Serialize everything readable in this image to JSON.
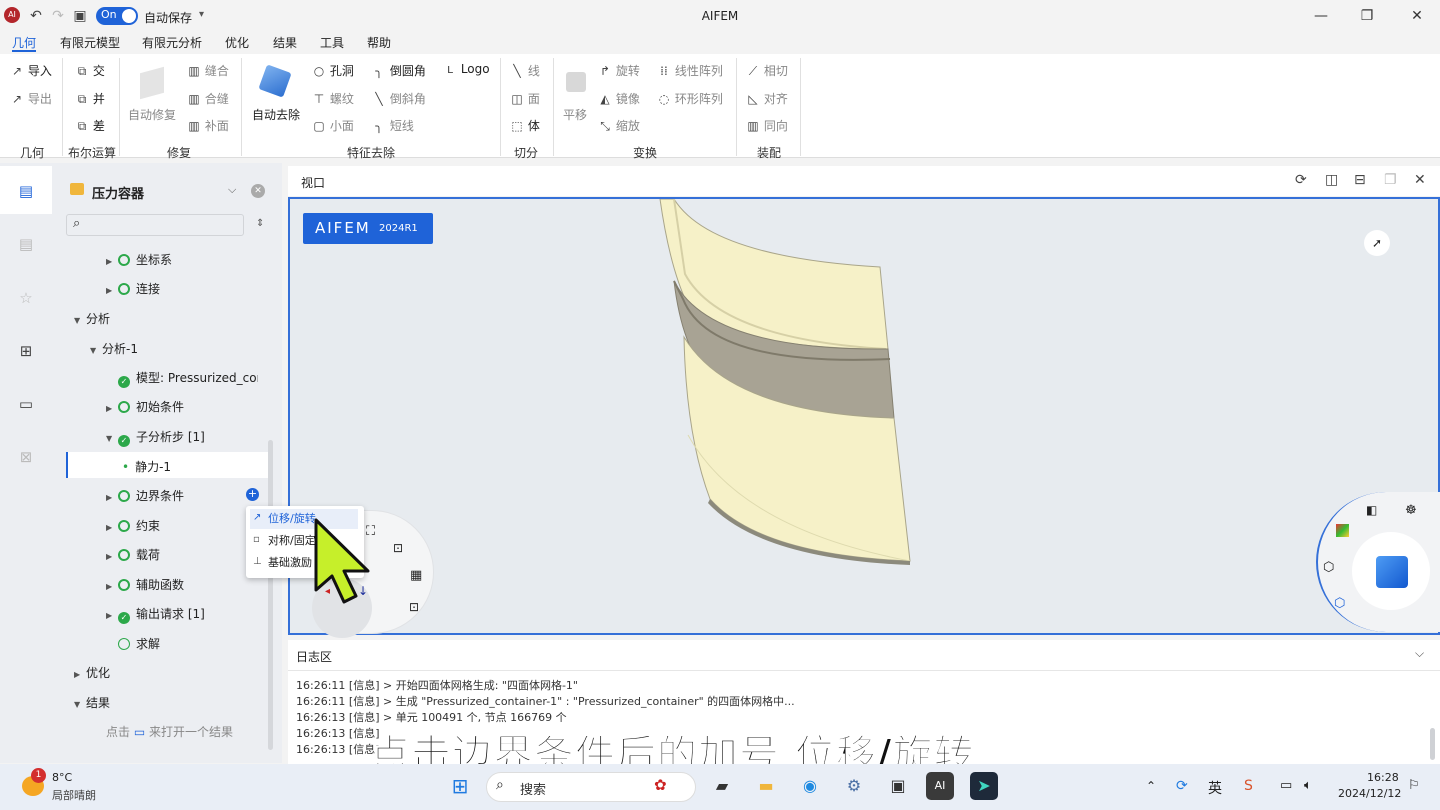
{
  "app": {
    "title": "AIFEM",
    "autosave_toggle": "On",
    "autosave_label": "自动保存",
    "logo_text": "AI"
  },
  "menu": [
    "几何",
    "有限元模型",
    "有限元分析",
    "优化",
    "结果",
    "工具",
    "帮助"
  ],
  "ribbon": {
    "geometry": {
      "import": "导入",
      "export": "导出",
      "group": "几何"
    },
    "boolean": {
      "intersect": "交",
      "union": "并",
      "subtract": "差",
      "group": "布尔运算"
    },
    "repair": {
      "auto_repair": "自动修复",
      "sew": "缝合",
      "merge": "合缝",
      "fill": "补面",
      "group": "修复"
    },
    "feature": {
      "auto_remove": "自动去除",
      "hole": "孔洞",
      "thread": "螺纹",
      "small_face": "小面",
      "fillet": "倒圆角",
      "chamfer": "倒斜角",
      "short_edge": "短线",
      "logo": "Logo",
      "group": "特征去除"
    },
    "cut": {
      "line": "线",
      "face": "面",
      "body": "体",
      "group": "切分"
    },
    "transform": {
      "translate": "平移",
      "rotate": "旋转",
      "mirror": "镜像",
      "scale": "缩放",
      "linear_array": "线性阵列",
      "circular_array": "环形阵列",
      "group": "变换"
    },
    "assembly": {
      "tangent": "相切",
      "align": "对齐",
      "same_dir": "同向",
      "group": "装配"
    }
  },
  "tree": {
    "title": "压力容器",
    "items": [
      "坐标系",
      "连接",
      "分析",
      "分析-1",
      "模型:",
      "Pressurized_cor",
      "初始条件",
      "子分析步 [1]",
      "静力-1",
      "边界条件",
      "约束",
      "载荷",
      "辅助函数",
      "输出请求 [1]",
      "求解",
      "优化",
      "结果",
      "点击",
      "来打开一个结果"
    ]
  },
  "viewport": {
    "title": "视口",
    "badge": "AIFEM",
    "badge_version": "2024R1"
  },
  "popup": [
    "位移/旋转",
    "对称/固定",
    "基础激励"
  ],
  "log": {
    "title": "日志区",
    "lines": [
      "16:26:11 [信息] > 开始四面体网格生成: \"四面体网格-1\"",
      "16:26:11 [信息] > 生成 \"Pressurized_container-1\" : \"Pressurized_container\" 的四面体网格中...",
      "16:26:13 [信息] > 单元 100491 个, 节点 166769 个",
      "16:26:13 [信息]",
      "16:26:13 [信息]"
    ]
  },
  "subtitle": "点击边界条件后的加号 位移/旋转",
  "taskbar": {
    "weather_temp": "8°C",
    "weather_desc": "局部晴朗",
    "weather_badge": "1",
    "search": "搜索",
    "time": "16:28",
    "date": "2024/12/12",
    "ime": "英"
  }
}
